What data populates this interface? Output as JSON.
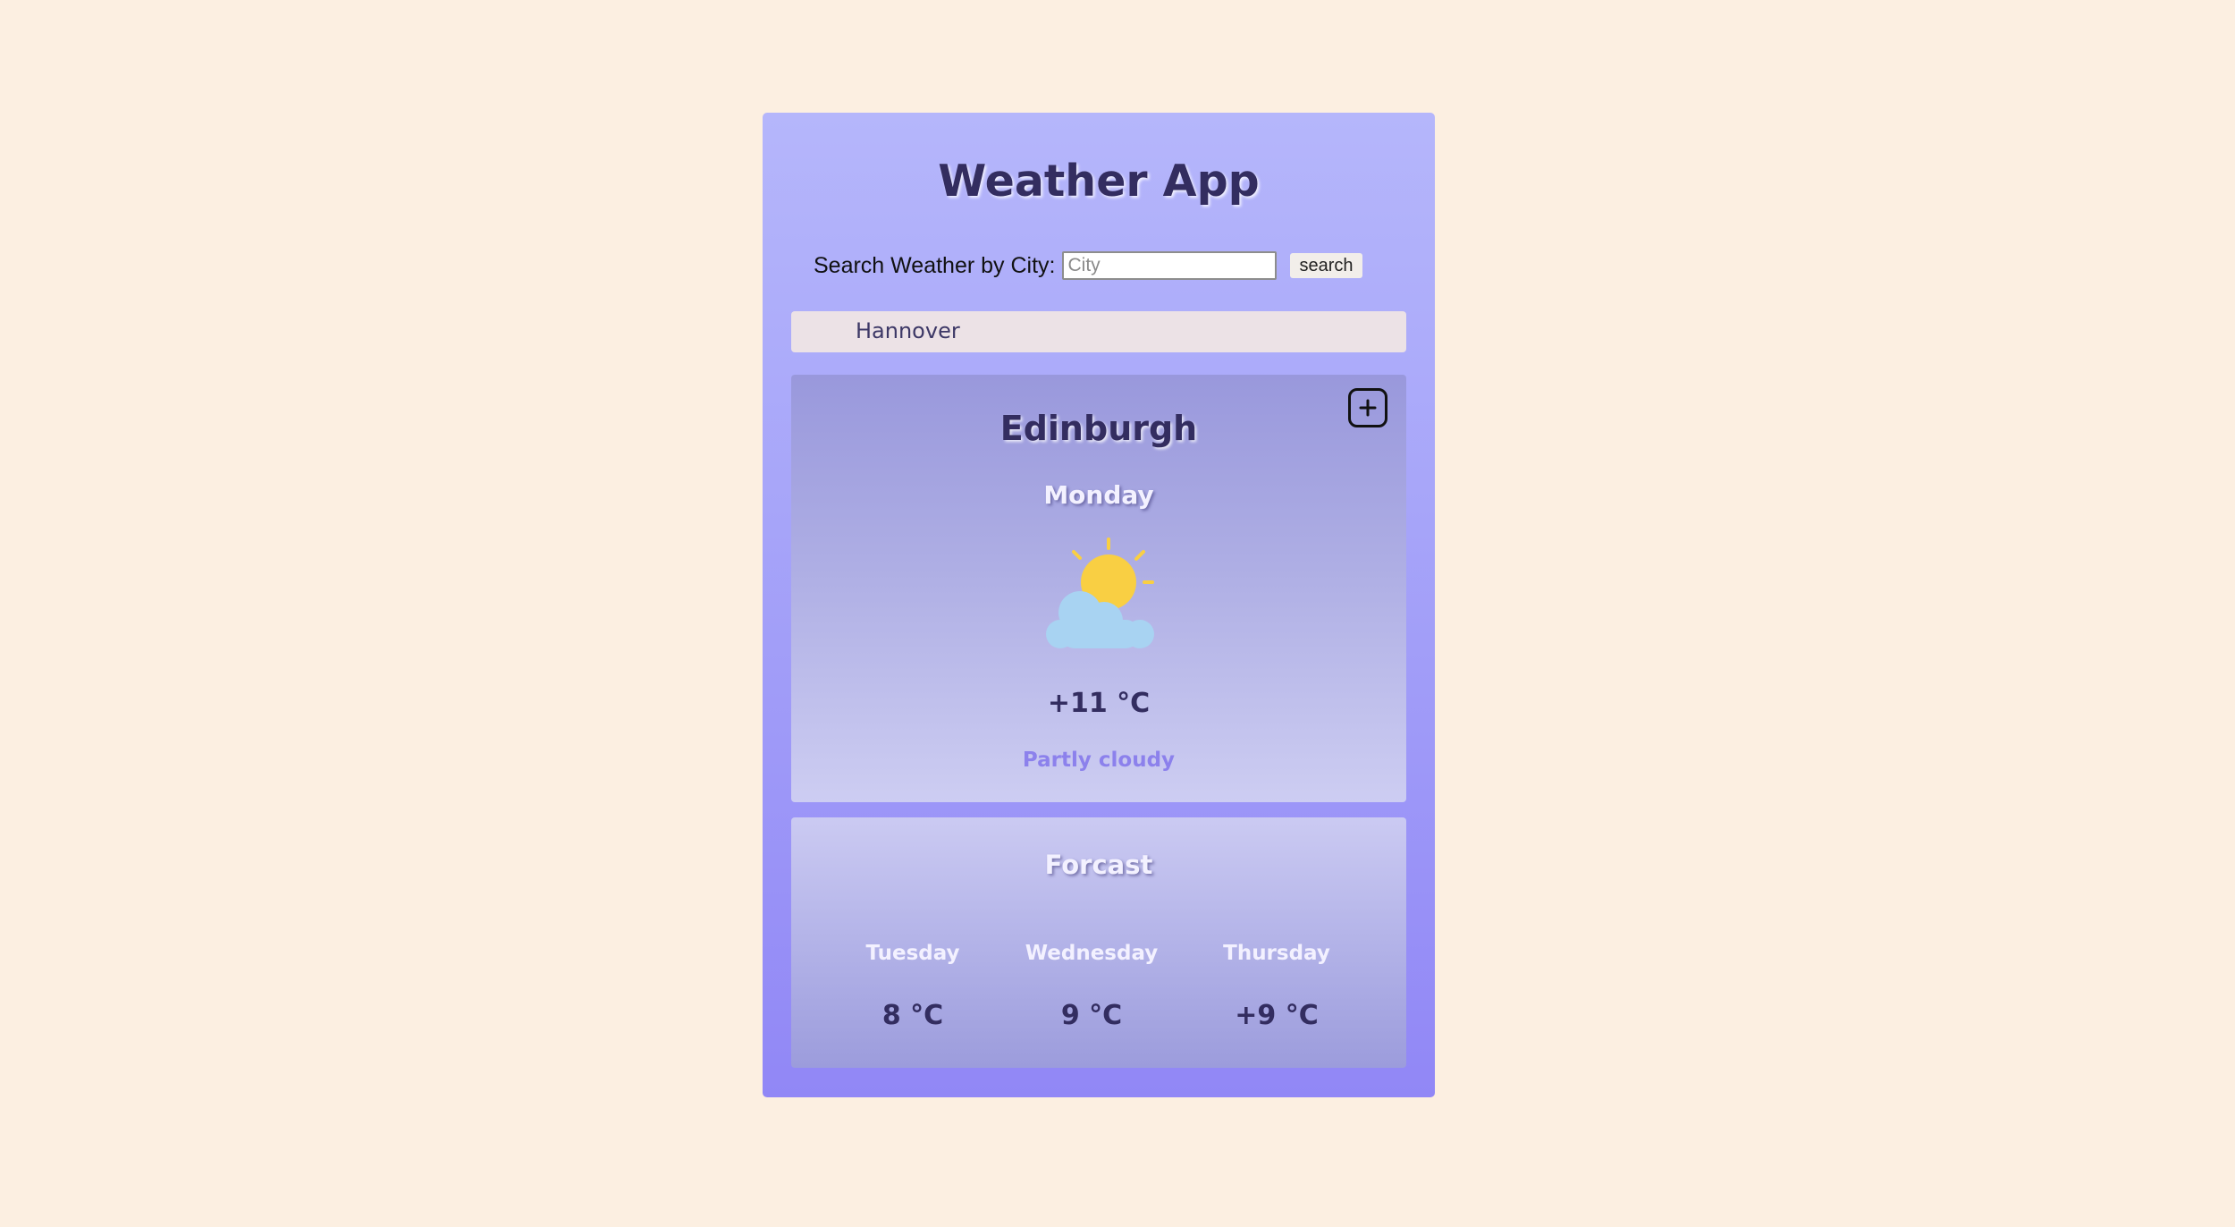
{
  "app": {
    "title": "Weather App"
  },
  "search": {
    "label": "Search Weather by City:",
    "value": "",
    "placeholder": "City",
    "button_label": "search"
  },
  "history": {
    "items": [
      "Hannover"
    ]
  },
  "current": {
    "city": "Edinburgh",
    "day": "Monday",
    "icon": "partly-cloudy-icon",
    "temperature": "+11 °C",
    "description": "Partly cloudy",
    "add_icon": "plus-square-icon"
  },
  "forecast": {
    "title": "Forcast",
    "days": [
      {
        "day": "Tuesday",
        "temperature": "8 °C"
      },
      {
        "day": "Wednesday",
        "temperature": "9 °C"
      },
      {
        "day": "Thursday",
        "temperature": "+9 °C"
      }
    ]
  },
  "colors": {
    "page_background": "#fcefe1",
    "app_gradient_top": "#b5b6fb",
    "app_gradient_bottom": "#9187f6",
    "text_dark": "#332d60",
    "description_accent": "#8c81ec",
    "sun": "#f9cf43",
    "cloud": "#a8d3f2"
  }
}
